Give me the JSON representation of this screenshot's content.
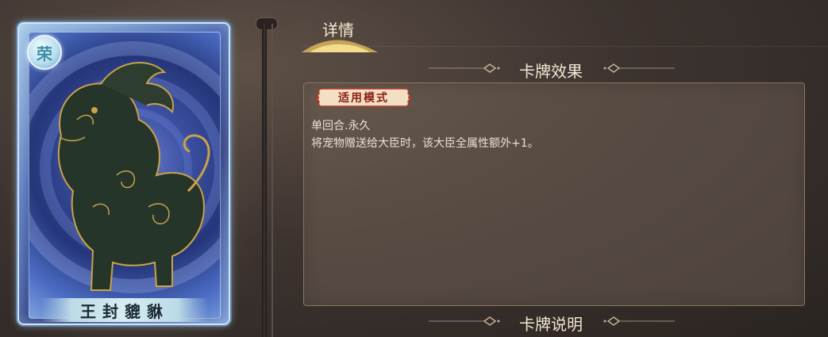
{
  "card": {
    "badge_char": "荣",
    "name": "王封貔貅"
  },
  "tabs": [
    {
      "label": "详情",
      "active": true
    }
  ],
  "effect_section": {
    "title": "卡牌效果",
    "mode_tag": "适用模式",
    "lines": [
      "单回合.永久",
      "将宠物赠送给大臣时，该大臣全属性额外+1。"
    ]
  },
  "description_section": {
    "title": "卡牌说明"
  },
  "colors": {
    "accent_gold": "#d9b45a",
    "card_blue": "#3a4ea0",
    "tag_red": "#8a1f14"
  }
}
